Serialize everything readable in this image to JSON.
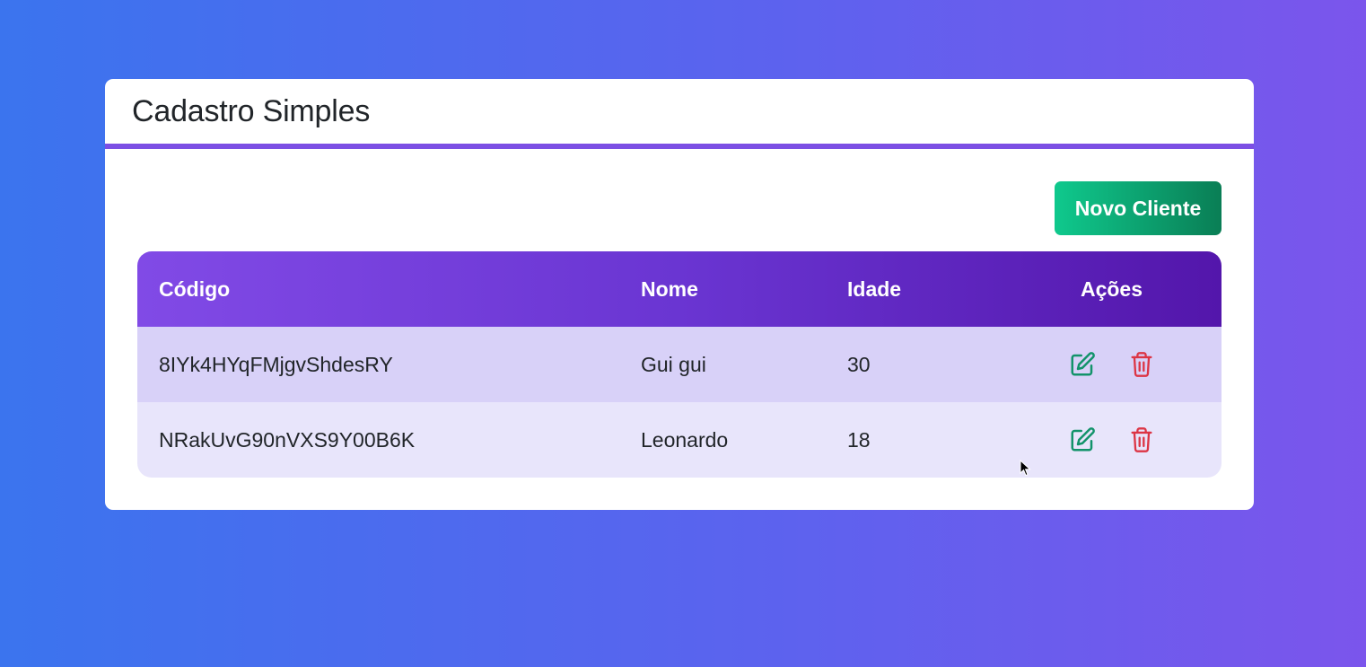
{
  "header": {
    "title": "Cadastro Simples"
  },
  "toolbar": {
    "new_label": "Novo Cliente"
  },
  "table": {
    "columns": [
      "Código",
      "Nome",
      "Idade",
      "Ações"
    ],
    "rows": [
      {
        "codigo": "8IYk4HYqFMjgvShdesRY",
        "nome": "Gui gui",
        "idade": "30"
      },
      {
        "codigo": "NRakUvG90nVXS9Y00B6K",
        "nome": "Leonardo",
        "idade": "18"
      }
    ]
  },
  "icons": {
    "edit": "edit-icon",
    "delete": "trash-icon"
  },
  "colors": {
    "accent": "#7c4fe4",
    "new_button": "#0fc98d",
    "edit_icon": "#12936a",
    "delete_icon": "#dc3545"
  }
}
